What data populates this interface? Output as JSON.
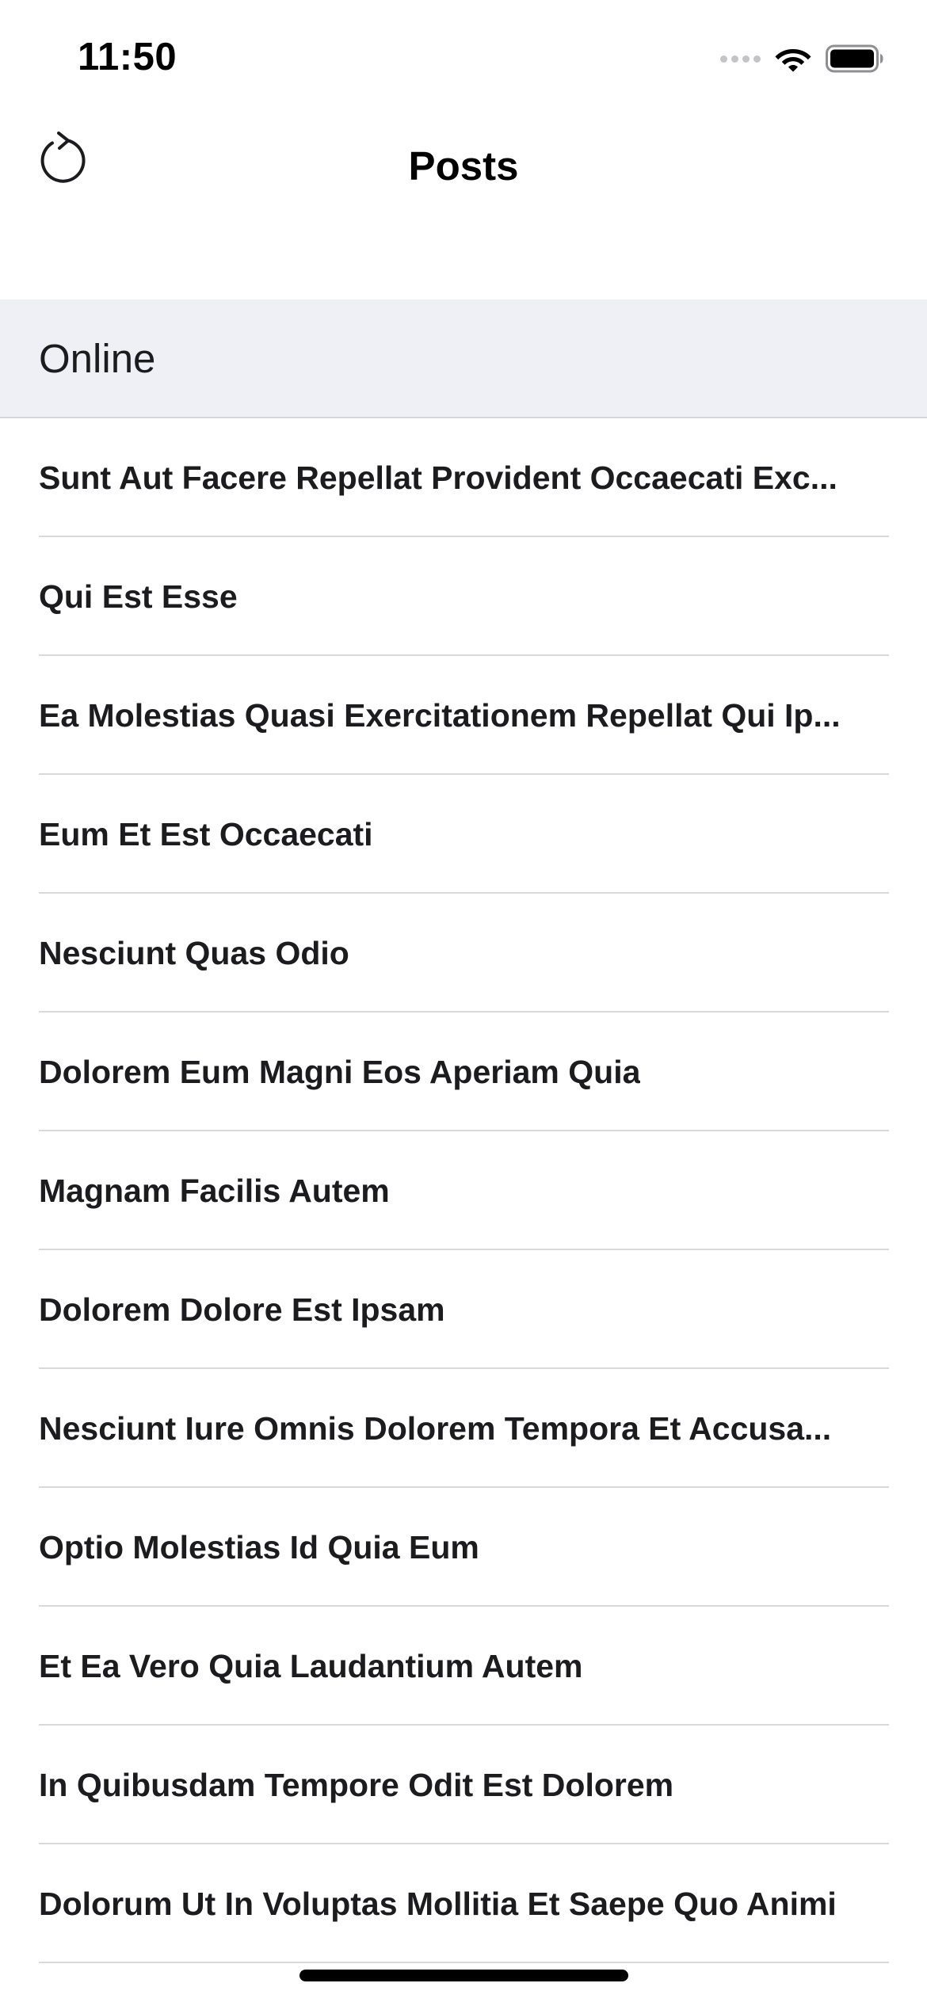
{
  "status_bar": {
    "time": "11:50",
    "icons": [
      "signal-icon",
      "wifi-icon",
      "battery-icon"
    ]
  },
  "nav": {
    "title": "Posts",
    "left_icon": "refresh-icon"
  },
  "section": {
    "header": "Online"
  },
  "posts": [
    "Sunt Aut Facere Repellat Provident Occaecati Exc...",
    "Qui Est Esse",
    "Ea Molestias Quasi Exercitationem Repellat Qui Ip...",
    "Eum Et Est Occaecati",
    "Nesciunt Quas Odio",
    "Dolorem Eum Magni Eos Aperiam Quia",
    "Magnam Facilis Autem",
    "Dolorem Dolore Est Ipsam",
    "Nesciunt Iure Omnis Dolorem Tempora Et Accusa...",
    "Optio Molestias Id Quia Eum",
    "Et Ea Vero Quia Laudantium Autem",
    "In Quibusdam Tempore Odit Est Dolorem",
    "Dolorum Ut In Voluptas Mollitia Et Saepe Quo Animi"
  ],
  "colors": {
    "section_background": "#eff0f5",
    "separator": "#d9d9dc",
    "text": "#1c1c1e"
  }
}
